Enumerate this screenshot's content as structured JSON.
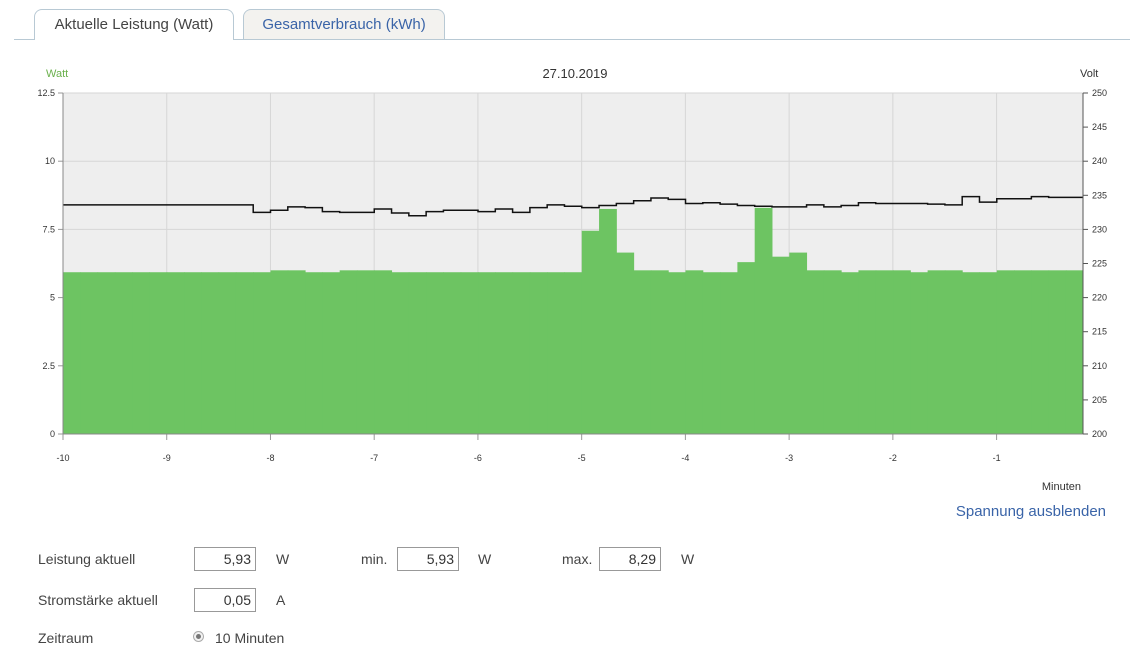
{
  "tabs": [
    {
      "label": "Aktuelle Leistung (Watt)",
      "active": true
    },
    {
      "label": "Gesamtverbrauch (kWh)",
      "active": false
    }
  ],
  "chart_data": {
    "type": "bar",
    "title": "27.10.2019",
    "ylabel": "Watt",
    "y2label": "Volt",
    "xlabel": "Minuten",
    "ylim": [
      0,
      12.5
    ],
    "y2lim": [
      200,
      250
    ],
    "xlim": [
      -10,
      -0.167
    ],
    "yticks": [
      "0",
      "2.5",
      "5",
      "7.5",
      "10",
      "12.5"
    ],
    "y2ticks": [
      "200",
      "205",
      "210",
      "215",
      "220",
      "225",
      "230",
      "235",
      "240",
      "245",
      "250"
    ],
    "xticks": [
      "-10",
      "-9",
      "-8",
      "-7",
      "-6",
      "-5",
      "-4",
      "-3",
      "-2",
      "-1"
    ],
    "bar_interval_min": 0.1667,
    "series": [
      {
        "name": "Watt",
        "type": "bar",
        "color": "#6dc462",
        "values": [
          5.93,
          5.93,
          5.93,
          5.93,
          5.93,
          5.93,
          5.93,
          5.93,
          5.93,
          5.93,
          5.93,
          5.93,
          6.0,
          6.0,
          5.93,
          5.93,
          6.0,
          6.0,
          6.0,
          5.93,
          5.93,
          5.93,
          5.93,
          5.93,
          5.93,
          5.93,
          5.93,
          5.93,
          5.93,
          5.93,
          7.45,
          8.25,
          6.65,
          6.0,
          6.0,
          5.93,
          6.0,
          5.93,
          5.93,
          6.3,
          8.29,
          6.5,
          6.65,
          6.0,
          6.0,
          5.93,
          6.0,
          6.0,
          6.0,
          5.93,
          6.0,
          6.0,
          5.93,
          5.93,
          6.0,
          6.0,
          6.0,
          6.0,
          6.0
        ]
      },
      {
        "name": "Volt",
        "type": "step",
        "color": "#111111",
        "values": [
          233.6,
          233.6,
          233.6,
          233.6,
          233.6,
          233.6,
          233.6,
          233.6,
          233.6,
          233.6,
          233.6,
          232.5,
          232.8,
          233.3,
          233.2,
          232.6,
          232.5,
          232.5,
          233.0,
          232.4,
          232.0,
          232.6,
          232.8,
          232.8,
          232.6,
          233.0,
          232.5,
          233.2,
          233.6,
          233.4,
          233.2,
          233.5,
          233.8,
          234.2,
          234.6,
          234.4,
          233.8,
          233.9,
          233.7,
          233.5,
          233.4,
          233.3,
          233.3,
          233.6,
          233.3,
          233.5,
          233.9,
          233.8,
          233.8,
          233.8,
          233.7,
          233.6,
          234.8,
          234.0,
          234.5,
          234.5,
          234.8,
          234.7,
          234.7
        ]
      }
    ]
  },
  "toggle_voltage_link": "Spannung ausblenden",
  "form": {
    "power_label": "Leistung aktuell",
    "power_value": "5,93",
    "unit_w": "W",
    "min_label": "min.",
    "min_value": "5,93",
    "max_label": "max.",
    "max_value": "8,29",
    "current_label": "Stromstärke aktuell",
    "current_value": "0,05",
    "unit_a": "A",
    "period_label": "Zeitraum",
    "period_option": "10 Minuten"
  }
}
